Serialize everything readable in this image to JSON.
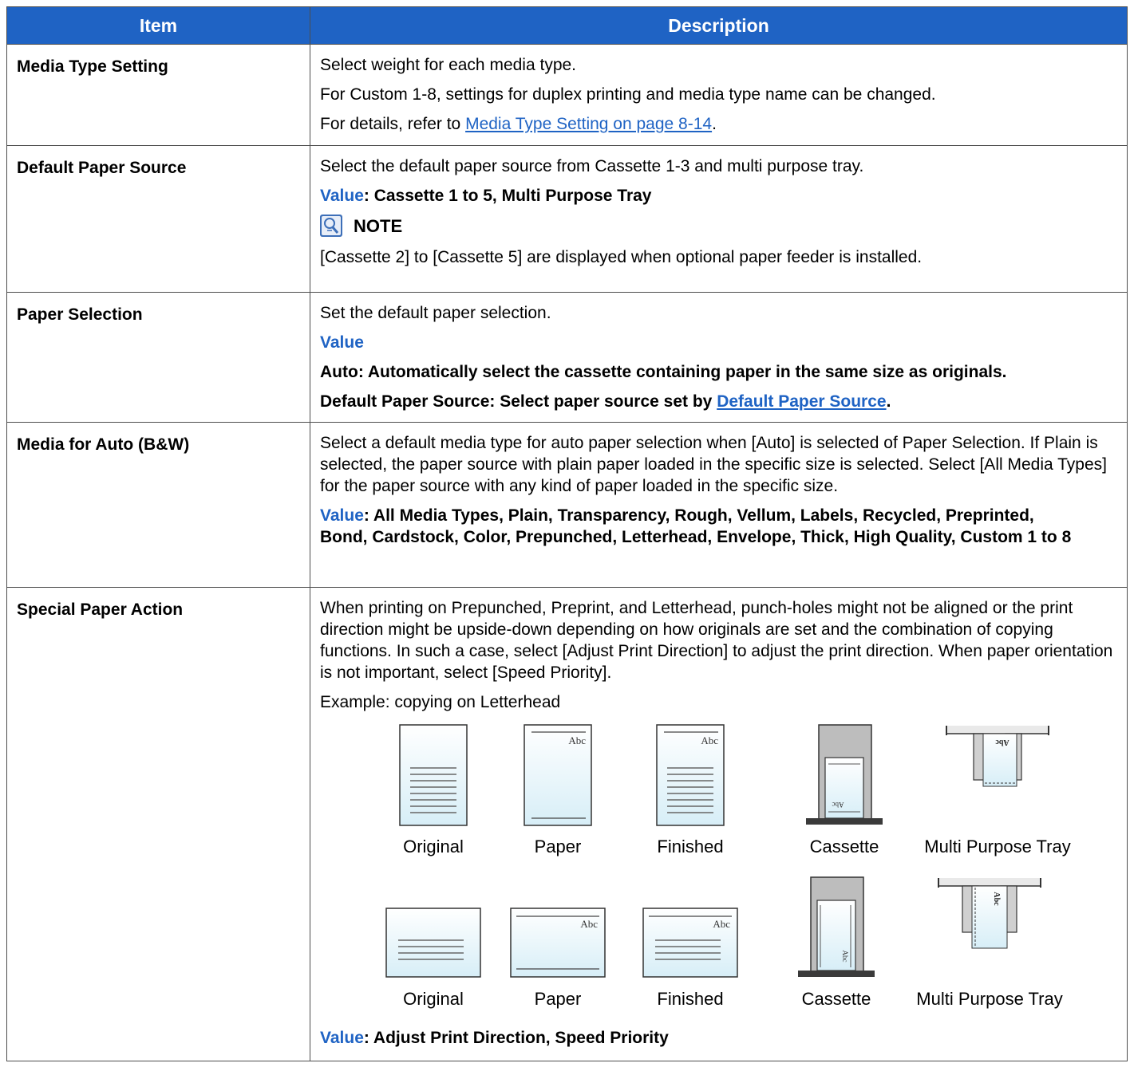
{
  "header": {
    "item": "Item",
    "description": "Description"
  },
  "rows": {
    "media_type": {
      "item": "Media Type Setting",
      "lines": [
        "Select weight for each media type.",
        "For Custom 1-8, settings for duplex printing and media type name can be changed."
      ],
      "ref_prefix": "For details, refer to ",
      "ref_link": "Media Type Setting on page 8-14",
      "ref_suffix": "."
    },
    "default_source": {
      "item": "Default Paper Source",
      "desc": "Select the default paper source from Cassette 1-3 and multi purpose tray.",
      "value_label": "Value",
      "value_text": ": Cassette 1 to 5, Multi Purpose Tray",
      "note_title": "NOTE",
      "note_text": "[Cassette 2] to [Cassette 5] are displayed when optional paper feeder is installed."
    },
    "paper_selection": {
      "item": "Paper Selection",
      "desc": "Set the default paper selection.",
      "value_label": "Value",
      "auto_text": "Auto: Automatically select the cassette containing paper in the same size as originals.",
      "source_prefix": "Default Paper Source: Select paper source set by ",
      "source_link": "Default Paper Source",
      "source_suffix": "."
    },
    "media_auto": {
      "item": "Media for Auto (B&W)",
      "desc": "Select a default media type for auto paper selection when [Auto] is selected of Paper Selection. If Plain is selected, the paper source with plain paper loaded in the specific size is selected. Select [All Media Types] for the paper source with any kind of paper loaded in the specific size.",
      "value_label": "Value",
      "value_text": ": All Media Types, Plain, Transparency, Rough, Vellum, Labels, Recycled, Preprinted, Bond, Cardstock, Color, Prepunched, Letterhead, Envelope, Thick, High Quality, Custom 1 to 8"
    },
    "special_action": {
      "item": "Special Paper Action",
      "desc": "When printing on Prepunched, Preprint, and Letterhead, punch-holes might not be aligned or the print direction might be upside-down depending on how originals are set and the combination of copying functions. In such a case, select [Adjust Print Direction] to adjust the print direction. When paper orientation is not important, select [Speed Priority].",
      "example": "Example: copying on Letterhead",
      "portrait_captions": [
        "Original",
        "Paper",
        "Finished",
        "Cassette",
        "Multi Purpose Tray"
      ],
      "landscape_captions": [
        "Original",
        "Paper",
        "Finished",
        "Cassette",
        "Multi Purpose Tray"
      ],
      "abc_label": "Abc",
      "value_label": "Value",
      "value_text": ": Adjust Print Direction, Speed Priority"
    }
  },
  "colors": {
    "header_bg": "#1f63c4",
    "accent": "#1f63c4",
    "border": "#4d4d4d",
    "tray_gray": "#bdbdbd"
  }
}
